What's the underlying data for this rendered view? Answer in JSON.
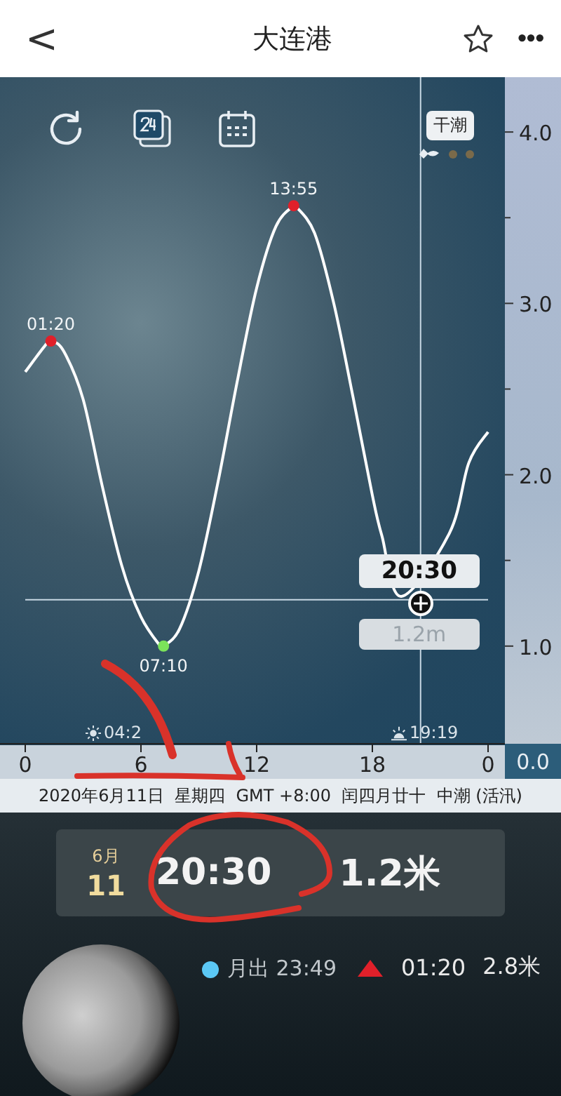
{
  "header": {
    "back": "<",
    "title": "大连港",
    "more": "•••"
  },
  "chart": {
    "tide_badge": "干潮",
    "zero_label": "0.0",
    "sunrise": "04:2",
    "sunset": "19:19",
    "cursor": {
      "time": "20:30",
      "height": "1.2m"
    },
    "x_end_label": "0",
    "chart_data": {
      "type": "line",
      "x": [
        0,
        1,
        1.33,
        2,
        3,
        4,
        5,
        6,
        7,
        7.17,
        8,
        9,
        10,
        11,
        12,
        13,
        13.92,
        14,
        15,
        16,
        17,
        18,
        18.5,
        19.5,
        22,
        23,
        24
      ],
      "series": [
        {
          "color": "#ffffff",
          "values": [
            2.6,
            2.75,
            2.78,
            2.72,
            2.44,
            1.93,
            1.47,
            1.17,
            1.0,
            1.0,
            1.1,
            1.44,
            1.96,
            2.55,
            3.09,
            3.45,
            3.57,
            3.57,
            3.41,
            3.0,
            2.45,
            1.88,
            1.64,
            1.29,
            1.66,
            2.07,
            2.25
          ]
        }
      ],
      "ref_lines": [
        {
          "axis": "x",
          "value": 20.5
        },
        {
          "axis": "y",
          "value": 1.27
        }
      ],
      "xlim": [
        0,
        24
      ],
      "ylim": [
        0.43,
        4.32
      ],
      "xticks": [
        0,
        6,
        12,
        18
      ],
      "yticks": [
        {
          "value": 1,
          "label": "1.0"
        },
        {
          "value": 2,
          "label": "2.0"
        },
        {
          "value": 3,
          "label": "3.0"
        },
        {
          "value": 4,
          "label": "4.0"
        }
      ],
      "annotations": [
        {
          "x": 1.33,
          "y": 2.78,
          "text": "01:20"
        },
        {
          "x": 7.17,
          "y": 1.0,
          "text": "07:10"
        },
        {
          "x": 13.92,
          "y": 3.57,
          "text": "13:55"
        }
      ]
    }
  },
  "date_bar": "2020年6月11日  星期四  GMT +8:00  闰四月廿十  中潮 (活汛)",
  "summary": {
    "month": "6月",
    "day": "11",
    "time": "20:30",
    "height": "1.2米"
  },
  "moon_events": [
    {
      "label": "月出 23:49",
      "color": "#5bc8f5"
    }
  ],
  "tides": [
    {
      "kind": "high",
      "time": "01:20",
      "height": "2.8米"
    }
  ]
}
